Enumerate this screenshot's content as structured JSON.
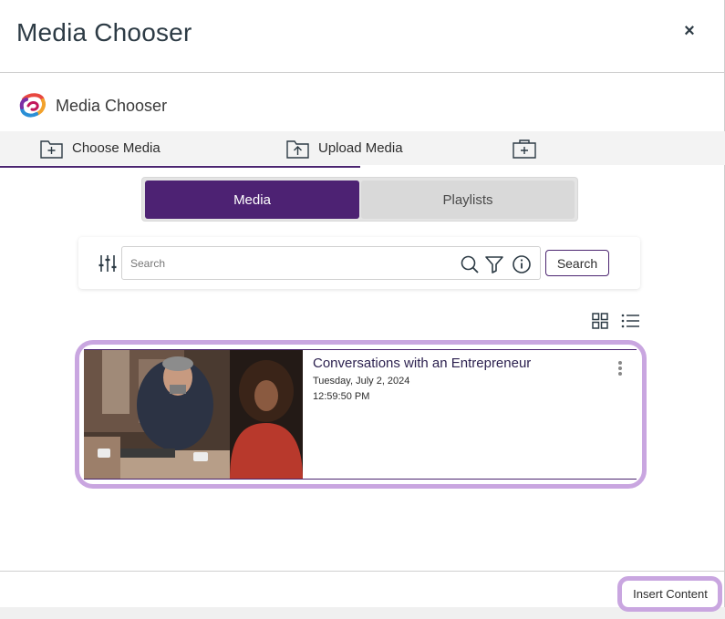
{
  "modal": {
    "title": "Media Chooser",
    "close_label": "×"
  },
  "brand": {
    "name": "Media Chooser"
  },
  "tabs": [
    {
      "label": "Choose Media",
      "icon": "folder-plus-icon",
      "active": true
    },
    {
      "label": "Upload Media",
      "icon": "folder-upload-icon",
      "active": false
    },
    {
      "label": "",
      "icon": "briefcase-plus-icon",
      "active": false
    }
  ],
  "segmented": {
    "media_label": "Media",
    "playlists_label": "Playlists",
    "selected": "Media"
  },
  "search": {
    "placeholder": "Search",
    "value": "",
    "button_label": "Search"
  },
  "results": [
    {
      "title": "Conversations with an Entrepreneur",
      "date": "Tuesday, July 2, 2024",
      "time": "12:59:50 PM"
    }
  ],
  "footer": {
    "insert_label": "Insert Content"
  },
  "colors": {
    "accent": "#4d2273",
    "focus_ring": "#c9a6e0",
    "tab_bg": "#f3f3f3"
  }
}
